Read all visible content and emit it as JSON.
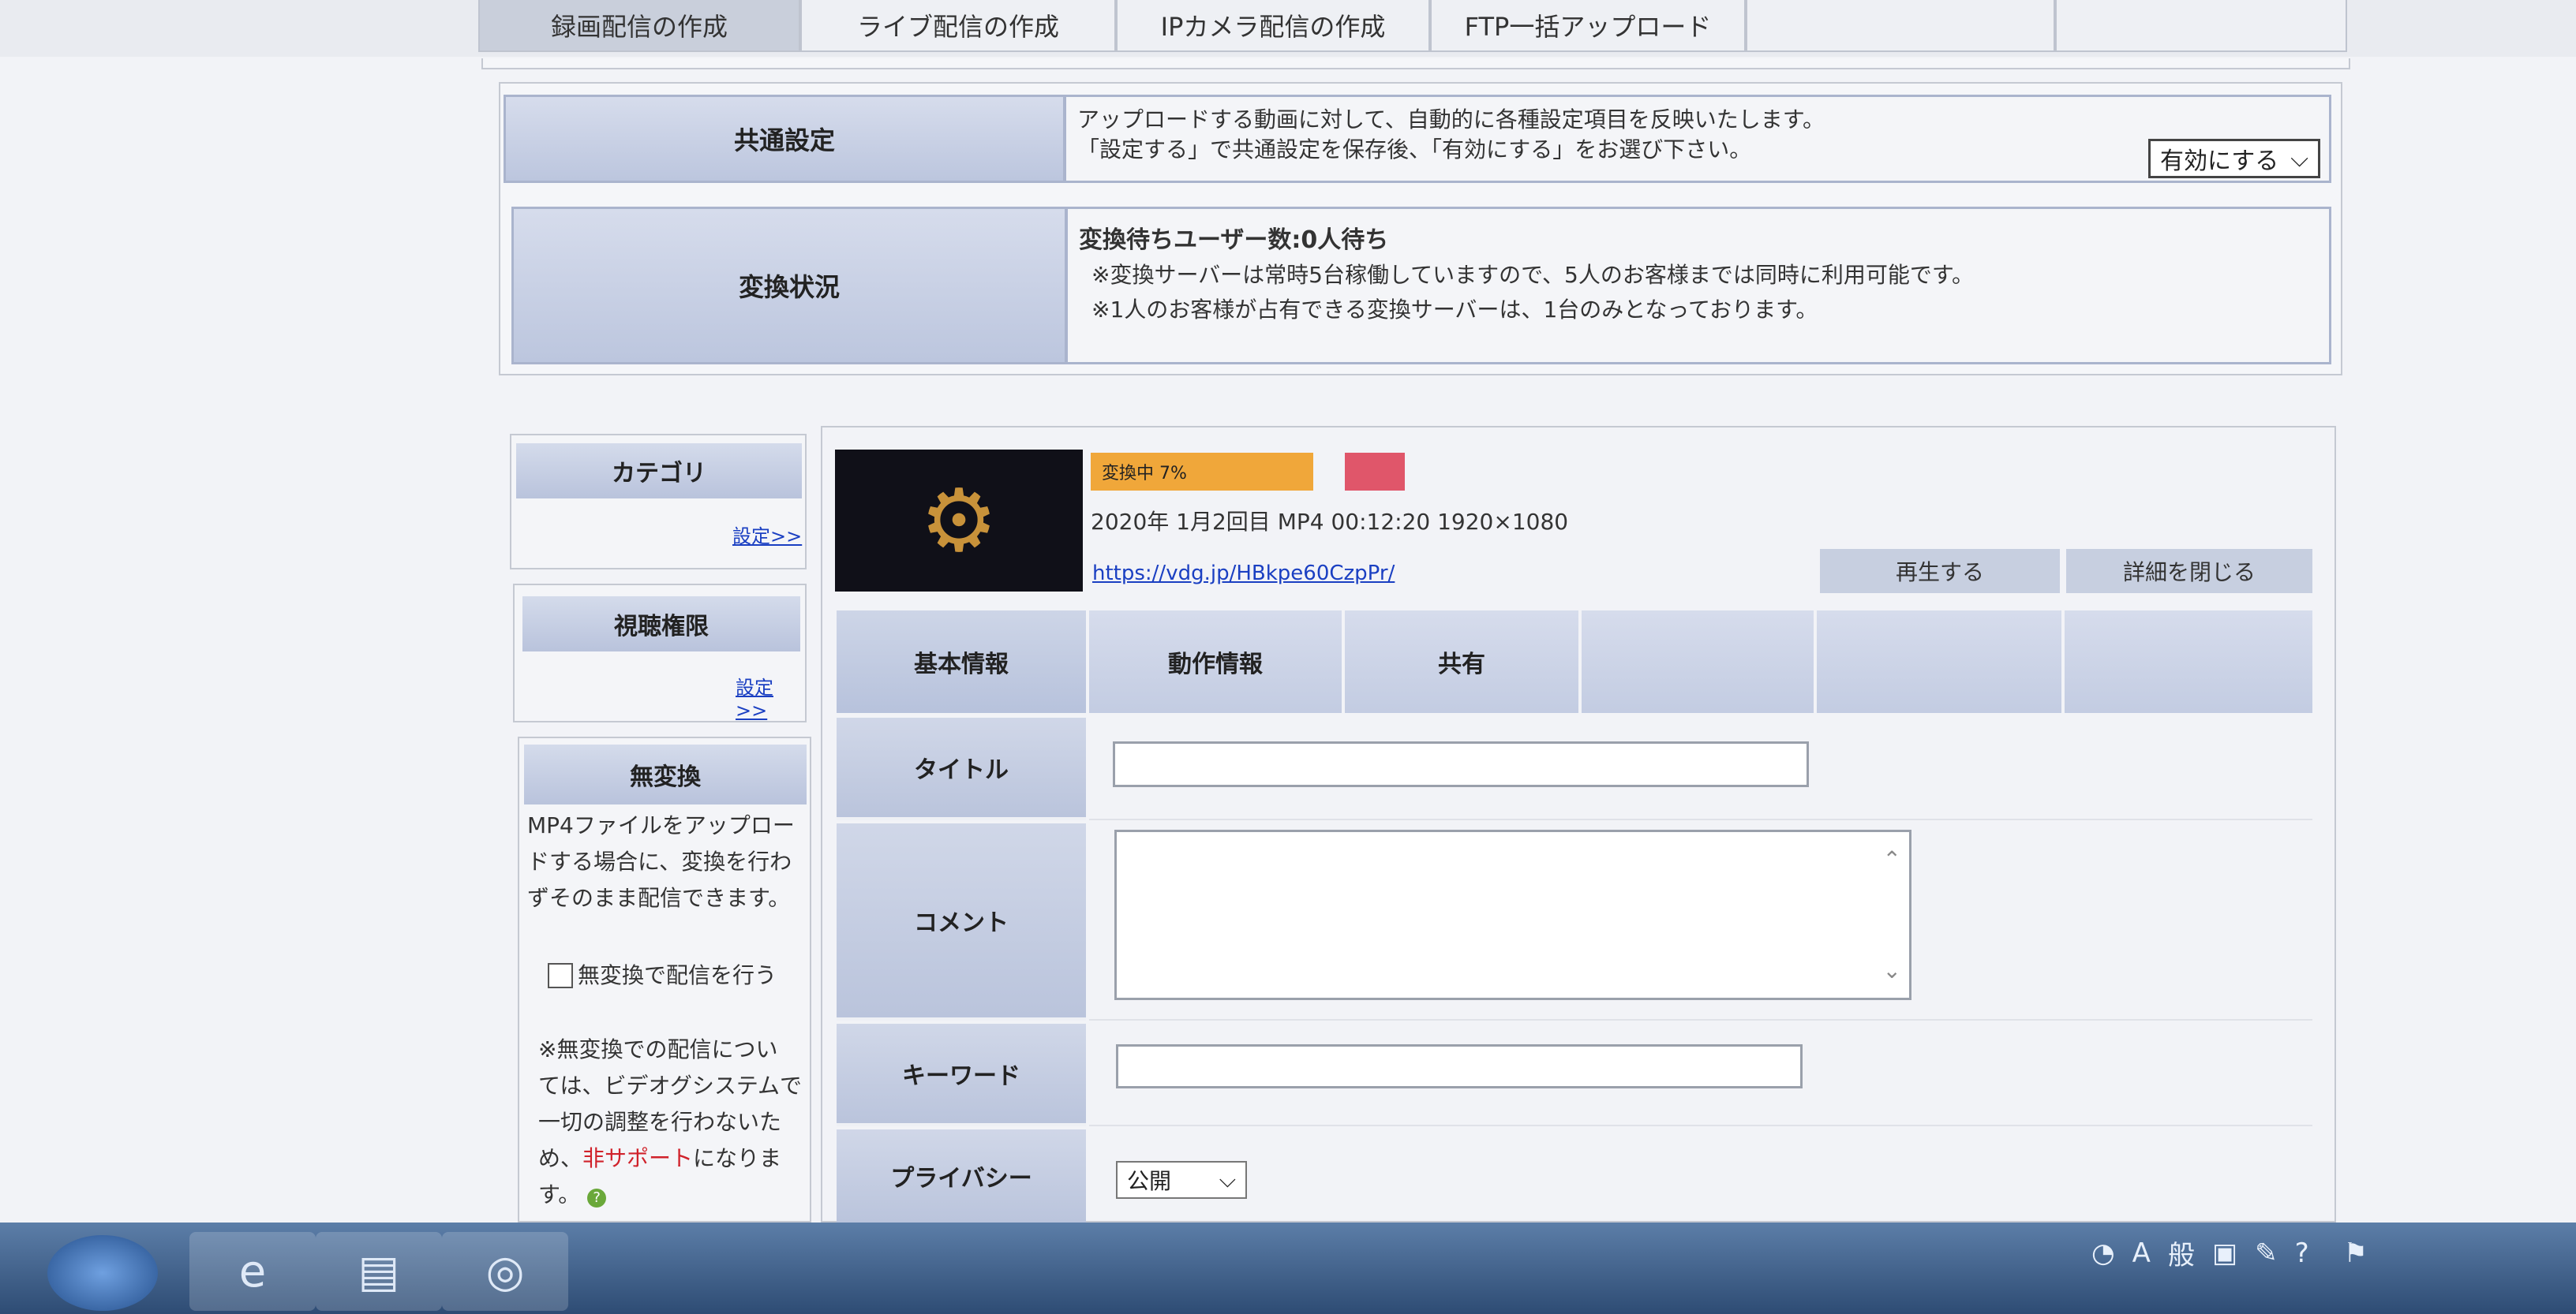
{
  "tabs": [
    {
      "label": "録画配信の作成",
      "active": true
    },
    {
      "label": "ライブ配信の作成",
      "active": false
    },
    {
      "label": "IPカメラ配信の作成",
      "active": false
    },
    {
      "label": "FTP一括アップロード",
      "active": false
    }
  ],
  "common": {
    "label": "共通設定",
    "line1": "アップロードする動画に対して、自動的に各種設定項目を反映いたします。",
    "line2": "「設定する」で共通設定を保存後、「有効にする」をお選び下さい。",
    "select_value": "有効にする"
  },
  "conversion": {
    "label": "変換状況",
    "heading": "変換待ちユーザー数:0人待ち",
    "note1": "※変換サーバーは常時5台稼働していますので、5人のお客様までは同時に利用可能です。",
    "note2": "※1人のお客様が占有できる変換サーバーは、1台のみとなっております。"
  },
  "sidebar": {
    "category": {
      "title": "カテゴリ",
      "link": "設定>>"
    },
    "permission": {
      "title": "視聴権限",
      "link": "設定>>"
    },
    "noconvert": {
      "title": "無変換",
      "desc": [
        "MP4ファイルをアップロー",
        "ドする場合に、変換を行わ",
        "ずそのまま配信できます。"
      ],
      "checkbox_label": "無変換で配信を行う",
      "note": [
        "※無変換での配信につい",
        "ては、ビデオグシステムで",
        "一切の調整を行わないた"
      ],
      "note_last_prefix": "め、",
      "note_last_red": "非サポート",
      "note_last_suffix": "になりま",
      "note_end": "す。"
    }
  },
  "video": {
    "status": "変換中 7%",
    "meta": "2020年 1月2回目 MP4 00:12:20 1920×1080",
    "url": "https://vdg.jp/HBkpe60CzpPr/",
    "play_button": "再生する",
    "close_button": "詳細を閉じる",
    "colors": {
      "status": "#f0a73a",
      "marker": "#e0566a"
    }
  },
  "info_tabs": [
    "基本情報",
    "動作情報",
    "共有"
  ],
  "form": {
    "title_label": "タイトル",
    "comment_label": "コメント",
    "keyword_label": "キーワード",
    "privacy_label": "プライバシー",
    "privacy_value": "公開"
  }
}
